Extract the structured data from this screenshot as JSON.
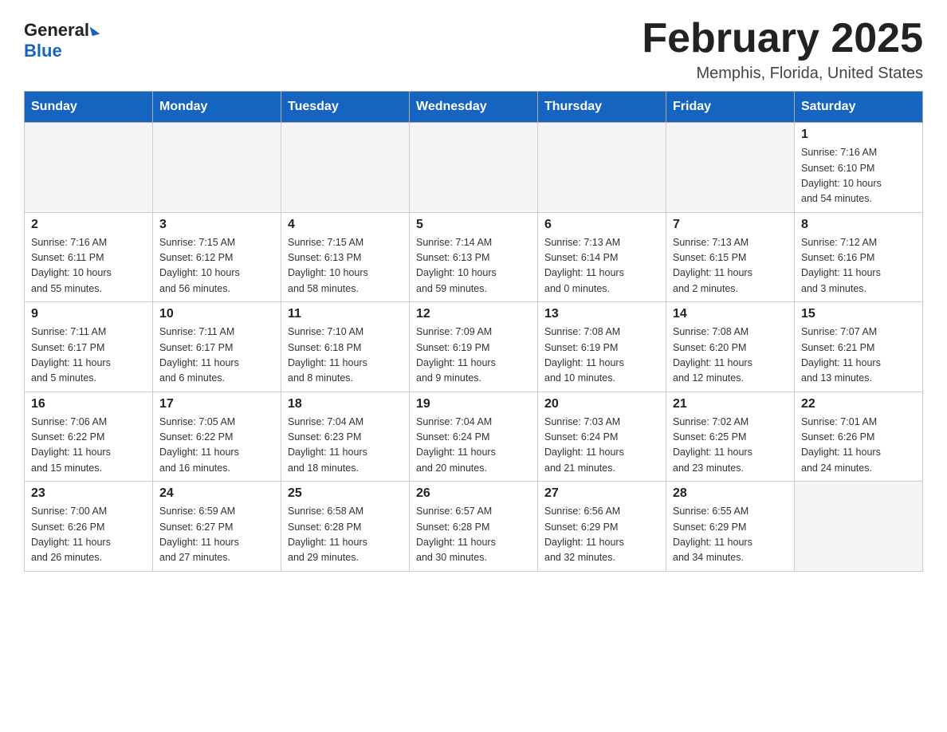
{
  "header": {
    "logo_general": "General",
    "logo_blue": "Blue",
    "title": "February 2025",
    "location": "Memphis, Florida, United States"
  },
  "days_of_week": [
    "Sunday",
    "Monday",
    "Tuesday",
    "Wednesday",
    "Thursday",
    "Friday",
    "Saturday"
  ],
  "weeks": [
    [
      {
        "day": "",
        "info": ""
      },
      {
        "day": "",
        "info": ""
      },
      {
        "day": "",
        "info": ""
      },
      {
        "day": "",
        "info": ""
      },
      {
        "day": "",
        "info": ""
      },
      {
        "day": "",
        "info": ""
      },
      {
        "day": "1",
        "info": "Sunrise: 7:16 AM\nSunset: 6:10 PM\nDaylight: 10 hours\nand 54 minutes."
      }
    ],
    [
      {
        "day": "2",
        "info": "Sunrise: 7:16 AM\nSunset: 6:11 PM\nDaylight: 10 hours\nand 55 minutes."
      },
      {
        "day": "3",
        "info": "Sunrise: 7:15 AM\nSunset: 6:12 PM\nDaylight: 10 hours\nand 56 minutes."
      },
      {
        "day": "4",
        "info": "Sunrise: 7:15 AM\nSunset: 6:13 PM\nDaylight: 10 hours\nand 58 minutes."
      },
      {
        "day": "5",
        "info": "Sunrise: 7:14 AM\nSunset: 6:13 PM\nDaylight: 10 hours\nand 59 minutes."
      },
      {
        "day": "6",
        "info": "Sunrise: 7:13 AM\nSunset: 6:14 PM\nDaylight: 11 hours\nand 0 minutes."
      },
      {
        "day": "7",
        "info": "Sunrise: 7:13 AM\nSunset: 6:15 PM\nDaylight: 11 hours\nand 2 minutes."
      },
      {
        "day": "8",
        "info": "Sunrise: 7:12 AM\nSunset: 6:16 PM\nDaylight: 11 hours\nand 3 minutes."
      }
    ],
    [
      {
        "day": "9",
        "info": "Sunrise: 7:11 AM\nSunset: 6:17 PM\nDaylight: 11 hours\nand 5 minutes."
      },
      {
        "day": "10",
        "info": "Sunrise: 7:11 AM\nSunset: 6:17 PM\nDaylight: 11 hours\nand 6 minutes."
      },
      {
        "day": "11",
        "info": "Sunrise: 7:10 AM\nSunset: 6:18 PM\nDaylight: 11 hours\nand 8 minutes."
      },
      {
        "day": "12",
        "info": "Sunrise: 7:09 AM\nSunset: 6:19 PM\nDaylight: 11 hours\nand 9 minutes."
      },
      {
        "day": "13",
        "info": "Sunrise: 7:08 AM\nSunset: 6:19 PM\nDaylight: 11 hours\nand 10 minutes."
      },
      {
        "day": "14",
        "info": "Sunrise: 7:08 AM\nSunset: 6:20 PM\nDaylight: 11 hours\nand 12 minutes."
      },
      {
        "day": "15",
        "info": "Sunrise: 7:07 AM\nSunset: 6:21 PM\nDaylight: 11 hours\nand 13 minutes."
      }
    ],
    [
      {
        "day": "16",
        "info": "Sunrise: 7:06 AM\nSunset: 6:22 PM\nDaylight: 11 hours\nand 15 minutes."
      },
      {
        "day": "17",
        "info": "Sunrise: 7:05 AM\nSunset: 6:22 PM\nDaylight: 11 hours\nand 16 minutes."
      },
      {
        "day": "18",
        "info": "Sunrise: 7:04 AM\nSunset: 6:23 PM\nDaylight: 11 hours\nand 18 minutes."
      },
      {
        "day": "19",
        "info": "Sunrise: 7:04 AM\nSunset: 6:24 PM\nDaylight: 11 hours\nand 20 minutes."
      },
      {
        "day": "20",
        "info": "Sunrise: 7:03 AM\nSunset: 6:24 PM\nDaylight: 11 hours\nand 21 minutes."
      },
      {
        "day": "21",
        "info": "Sunrise: 7:02 AM\nSunset: 6:25 PM\nDaylight: 11 hours\nand 23 minutes."
      },
      {
        "day": "22",
        "info": "Sunrise: 7:01 AM\nSunset: 6:26 PM\nDaylight: 11 hours\nand 24 minutes."
      }
    ],
    [
      {
        "day": "23",
        "info": "Sunrise: 7:00 AM\nSunset: 6:26 PM\nDaylight: 11 hours\nand 26 minutes."
      },
      {
        "day": "24",
        "info": "Sunrise: 6:59 AM\nSunset: 6:27 PM\nDaylight: 11 hours\nand 27 minutes."
      },
      {
        "day": "25",
        "info": "Sunrise: 6:58 AM\nSunset: 6:28 PM\nDaylight: 11 hours\nand 29 minutes."
      },
      {
        "day": "26",
        "info": "Sunrise: 6:57 AM\nSunset: 6:28 PM\nDaylight: 11 hours\nand 30 minutes."
      },
      {
        "day": "27",
        "info": "Sunrise: 6:56 AM\nSunset: 6:29 PM\nDaylight: 11 hours\nand 32 minutes."
      },
      {
        "day": "28",
        "info": "Sunrise: 6:55 AM\nSunset: 6:29 PM\nDaylight: 11 hours\nand 34 minutes."
      },
      {
        "day": "",
        "info": ""
      }
    ]
  ]
}
